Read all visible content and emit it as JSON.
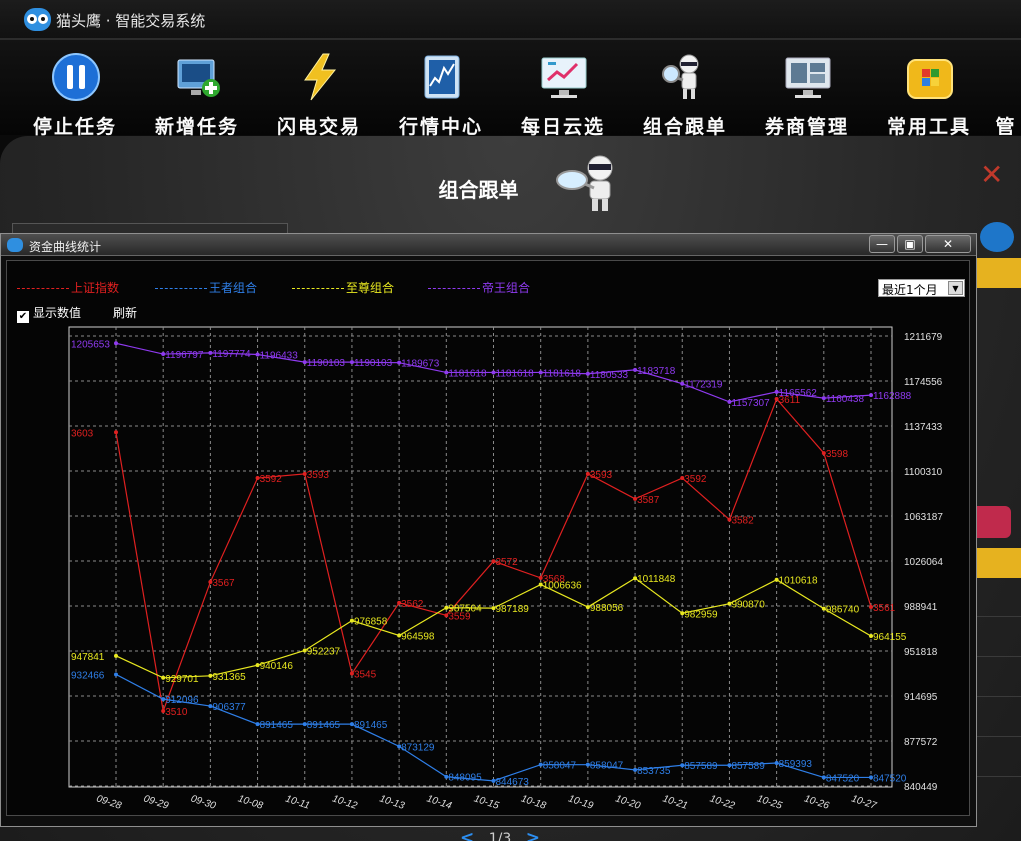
{
  "app": {
    "title": "猫头鹰 · 智能交易系统"
  },
  "toolbar": [
    {
      "label": "停止任务",
      "icon": "pause-icon"
    },
    {
      "label": "新增任务",
      "icon": "add-task-icon"
    },
    {
      "label": "闪电交易",
      "icon": "lightning-icon"
    },
    {
      "label": "行情中心",
      "icon": "market-chart-icon"
    },
    {
      "label": "每日云选",
      "icon": "monitor-trend-icon"
    },
    {
      "label": "组合跟单",
      "icon": "robot-magnifier-icon"
    },
    {
      "label": "券商管理",
      "icon": "broker-screen-icon"
    },
    {
      "label": "常用工具",
      "icon": "toolbox-icon"
    },
    {
      "label": "管",
      "icon": "more-icon"
    }
  ],
  "panel": {
    "title": "组合跟单",
    "close": "✕"
  },
  "pager": {
    "prev": "<",
    "text": "1/3",
    "next": ">"
  },
  "window": {
    "title": "资金曲线统计",
    "buttons": {
      "minimize": "—",
      "maximize": "▣",
      "close": "✕"
    },
    "show_values_label": "显示数值",
    "refresh_label": "刷新",
    "range_selected": "最近1个月"
  },
  "chart_data": {
    "type": "line",
    "categories": [
      "09-28",
      "09-29",
      "09-30",
      "10-08",
      "10-11",
      "10-12",
      "10-13",
      "10-14",
      "10-15",
      "10-18",
      "10-19",
      "10-20",
      "10-21",
      "10-22",
      "10-25",
      "10-26",
      "10-27"
    ],
    "ytick_labels": [
      "1211679",
      "1174556",
      "1137433",
      "1100310",
      "1063187",
      "1026064",
      "988941",
      "951818",
      "914695",
      "877572",
      "840449"
    ],
    "ylim": [
      840449,
      1211679
    ],
    "grid": true,
    "legend_position": "top-left",
    "series": [
      {
        "name": "上证指数",
        "color": "#e02020",
        "index_scale": true,
        "values": [
          3603,
          3536,
          3567,
          3592,
          3593,
          3545,
          3562,
          3559,
          3572,
          3568,
          3593,
          3587,
          3592,
          3582,
          3611,
          3598,
          3561
        ],
        "labels": [
          "3603",
          "3510",
          "3567",
          "3592",
          "3593",
          "3545",
          "3562",
          "3559",
          "3572",
          "3568",
          "3593",
          "3587",
          "3592",
          "3582",
          "3611",
          "3598",
          "3561"
        ]
      },
      {
        "name": "王者组合",
        "color": "#2f7fe8",
        "values": [
          932466,
          912096,
          906377,
          891465,
          891465,
          891465,
          873129,
          848095,
          844673,
          858047,
          858047,
          853735,
          857589,
          857589,
          859393,
          847520,
          847520
        ]
      },
      {
        "name": "至尊组合",
        "color": "#e8e820",
        "values": [
          947841,
          929701,
          931365,
          940146,
          952237,
          976858,
          964598,
          987504,
          987189,
          1006636,
          988056,
          1011848,
          982959,
          990870,
          1010618,
          986740,
          964155
        ]
      },
      {
        "name": "帝王组合",
        "color": "#8f3af0",
        "values": [
          1205653,
          1196797,
          1197774,
          1196433,
          1190103,
          1190103,
          1189673,
          1181618,
          1181618,
          1181618,
          1180533,
          1183718,
          1172319,
          1157307,
          1165562,
          1160438,
          1162888
        ]
      }
    ]
  }
}
